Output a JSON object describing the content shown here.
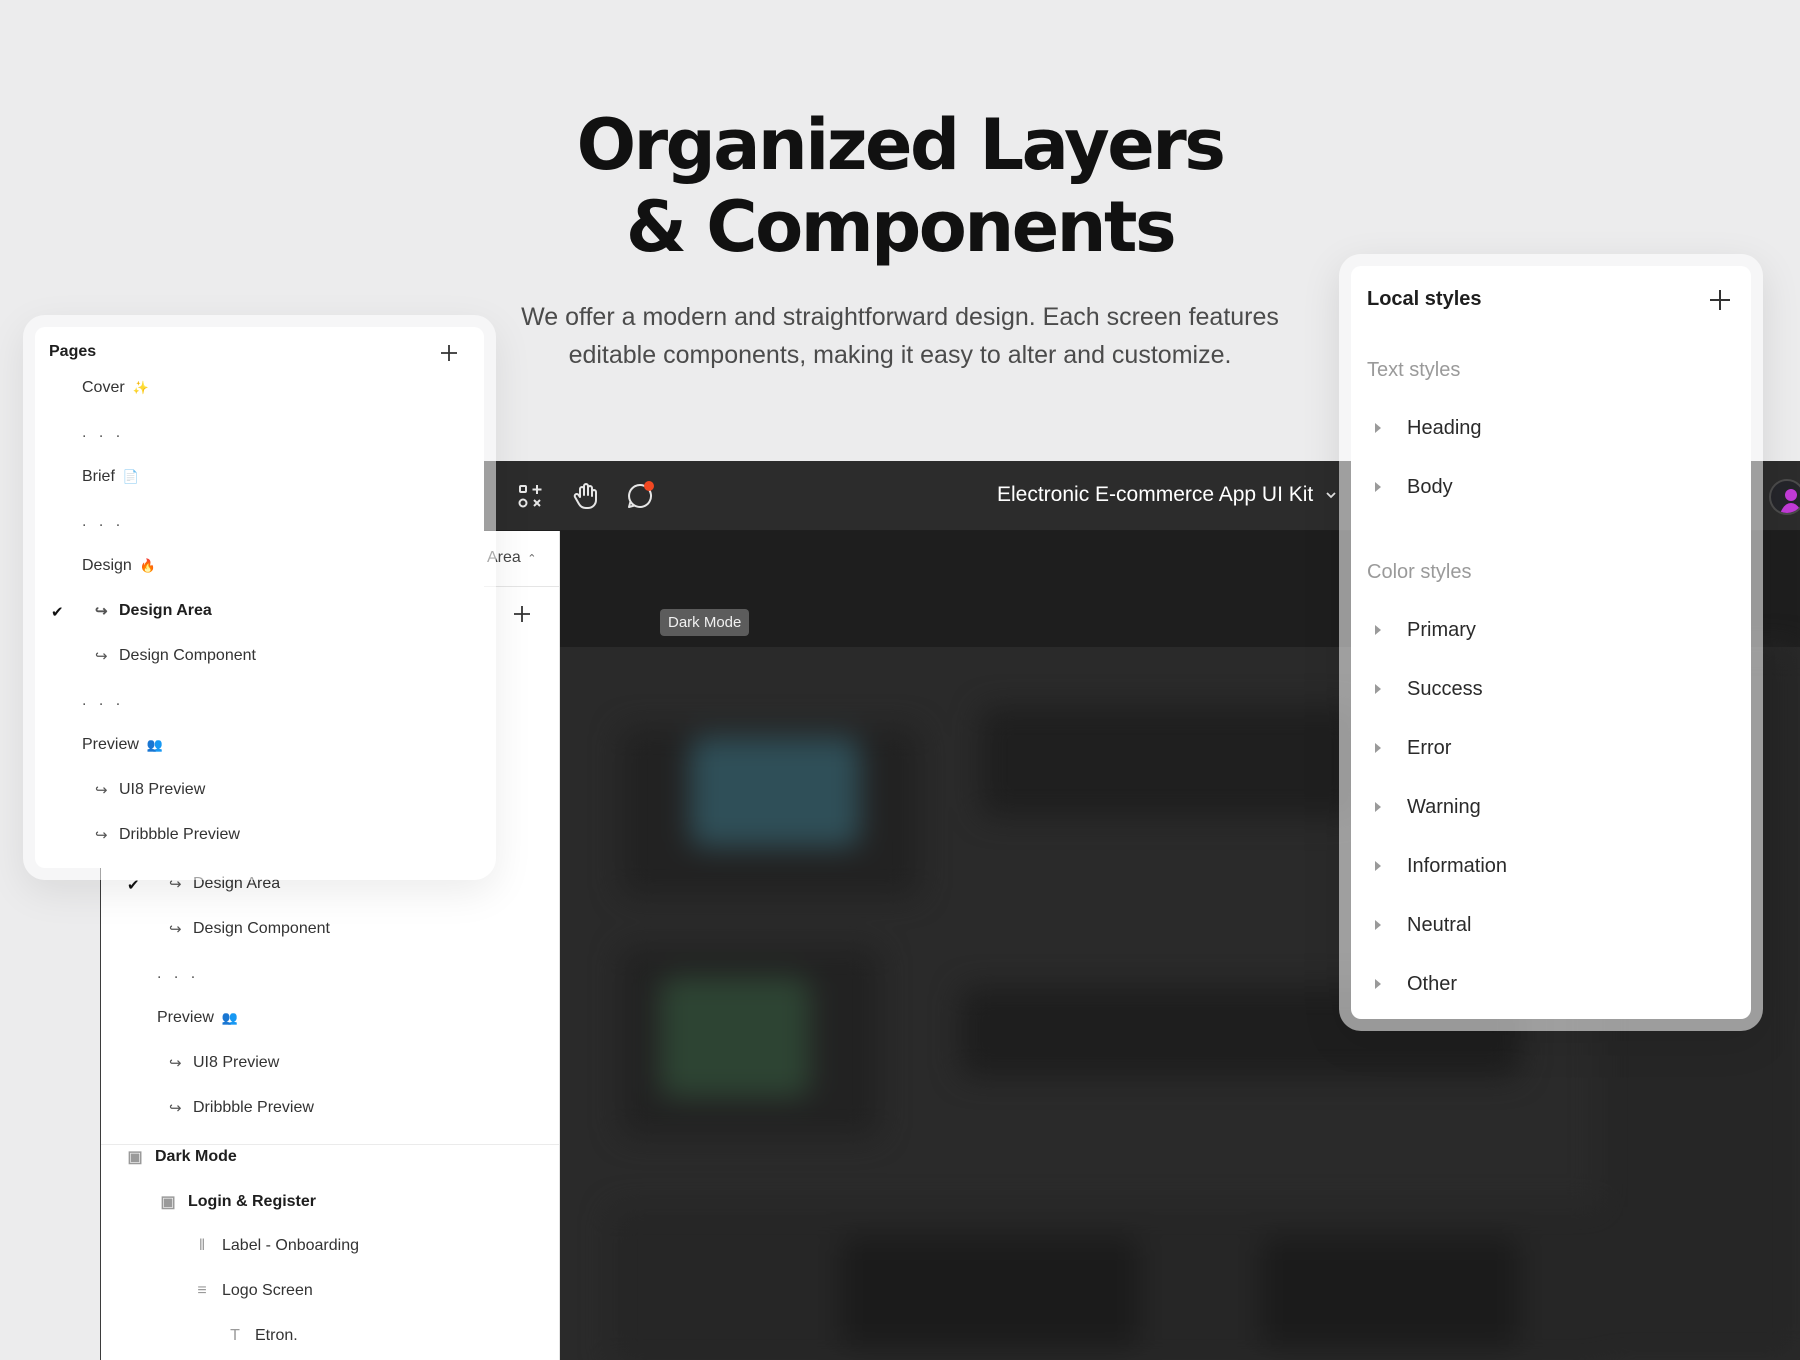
{
  "hero": {
    "title_line1": "Organized Layers",
    "title_line2": "& Components",
    "subtitle_line1": "We offer a modern and straightforward design. Each screen features",
    "subtitle_line2": "editable components, making it easy to alter and customize."
  },
  "app": {
    "file_title": "Electronic E-commerce App UI Kit",
    "frame_tag": "Dark Mode",
    "area_label": "Area",
    "toolbar_icons": [
      "components-icon",
      "hand-tool-icon",
      "comment-icon"
    ],
    "colors": {
      "toolbar": "#2c2c2c",
      "canvas": "#1e1e1e",
      "notification": "#f24822"
    }
  },
  "pages_panel": {
    "title": "Pages",
    "items": [
      {
        "label": "Cover",
        "emoji": "✨",
        "type": "page"
      },
      {
        "label": ". . .",
        "type": "separator"
      },
      {
        "label": "Brief",
        "emoji": "📄",
        "type": "page"
      },
      {
        "label": ". . .",
        "type": "separator"
      },
      {
        "label": "Design",
        "emoji": "🔥",
        "type": "page"
      },
      {
        "label": "Design Area",
        "type": "subpage",
        "checked": true
      },
      {
        "label": "Design Component",
        "type": "subpage"
      },
      {
        "label": ". . .",
        "type": "separator"
      },
      {
        "label": "Preview",
        "emoji": "👥",
        "type": "page"
      },
      {
        "label": "UI8 Preview",
        "type": "subpage"
      },
      {
        "label": "Dribbble Preview",
        "type": "subpage"
      }
    ]
  },
  "layers_panel": {
    "items": [
      {
        "label": "Design Area",
        "checked": true
      },
      {
        "label": "Design Component"
      },
      {
        "label": ". . ."
      },
      {
        "label": "Preview",
        "emoji": "👥"
      },
      {
        "label": "UI8 Preview"
      },
      {
        "label": "Dribbble Preview"
      },
      {
        "label": "Dark Mode",
        "icon": "frame-icon"
      },
      {
        "label": "Login & Register",
        "icon": "frame-icon"
      },
      {
        "label": "Label - Onboarding",
        "icon": "columns-icon"
      },
      {
        "label": "Logo Screen",
        "icon": "rows-icon"
      },
      {
        "label": "Etron.",
        "icon": "text-icon"
      }
    ]
  },
  "local_styles": {
    "title": "Local styles",
    "text_section": "Text styles",
    "text_styles": [
      "Heading",
      "Body"
    ],
    "color_section": "Color styles",
    "color_styles": [
      "Primary",
      "Success",
      "Error",
      "Warning",
      "Information",
      "Neutral",
      "Other"
    ]
  }
}
